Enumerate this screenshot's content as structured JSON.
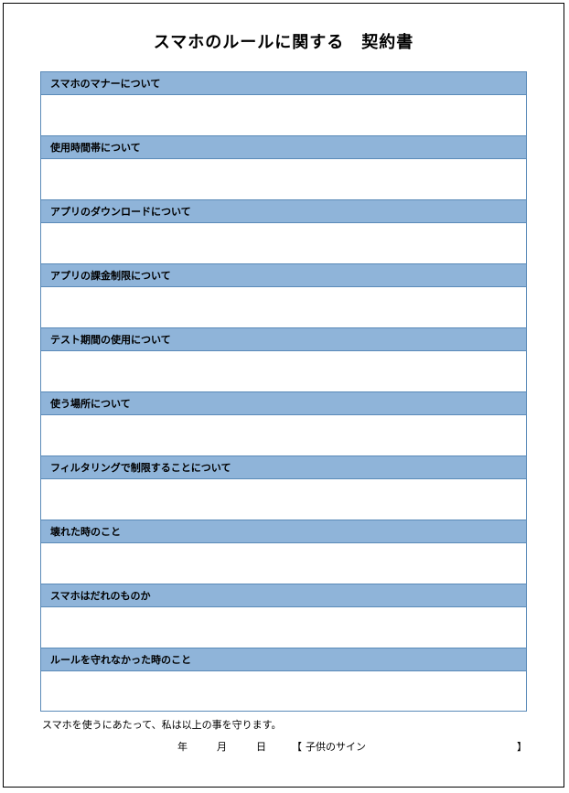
{
  "title": "スマホのルールに関する　契約書",
  "sections": [
    {
      "header": "スマホのマナーについて"
    },
    {
      "header": "使用時間帯について"
    },
    {
      "header": "アプリのダウンロードについて"
    },
    {
      "header": "アプリの課金制限について"
    },
    {
      "header": "テスト期間の使用について"
    },
    {
      "header": "使う場所について"
    },
    {
      "header": "フィルタリングで制限することについて"
    },
    {
      "header": "壊れた時のこと"
    },
    {
      "header": "スマホはだれのものか"
    },
    {
      "header": "ルールを守れなかった時のこと"
    }
  ],
  "footer": {
    "pledge": "スマホを使うにあたって、私は以上の事を守ります。",
    "year_label": "年",
    "month_label": "月",
    "day_label": "日",
    "bracket_open": "【",
    "sign_label": "子供のサイン",
    "bracket_close": "】"
  }
}
